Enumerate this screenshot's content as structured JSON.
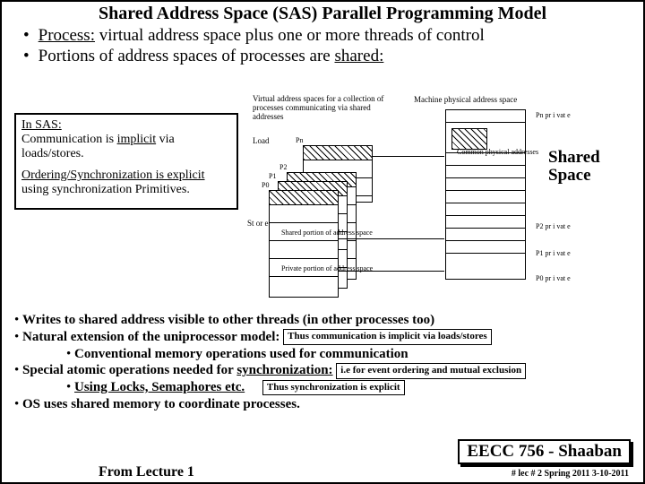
{
  "title": "Shared Address Space (SAS) Parallel Programming Model",
  "top_bullets": {
    "b1_pre": "Process:",
    "b1_post": " virtual address space plus one or more threads of control",
    "b2_pre": "Portions of address spaces of processes are ",
    "b2_u": "shared:"
  },
  "leftbox": {
    "p1_u": "In SAS:",
    "p1_rest_a": "Communication is ",
    "p1_rest_b": "implicit",
    "p1_rest_c": " via loads/stores.",
    "p2_a": "Ordering/Synchronization is ",
    "p2_b": "explicit",
    "p2_c": " using synchronization Primitives."
  },
  "diagram": {
    "caption1": "Virtual address spaces for a collection of processes communicating via shared addresses",
    "caption2": "Machine physical address space",
    "load": "Load",
    "store": "St or e",
    "pn": "Pn",
    "p2": "P2",
    "p1": "P1",
    "p0": "P0",
    "shared_portion": "Shared portion of address space",
    "private_portion": "Private portion of address space",
    "common_phys": "Common physical addresses",
    "pn_priv": "Pn pr i vat e",
    "p2_priv": "P2 pr i vat e",
    "p1_priv": "P1 pr i vat e",
    "p0_priv": "P0 pr i vat e",
    "shared_space": "Shared Space"
  },
  "bullets2": {
    "b1": "Writes to shared address visible to other threads (in other processes too)",
    "b2": "Natural extension of the uniprocessor model:",
    "b2_box": "Thus communication is implicit via loads/stores",
    "b2s": "Conventional memory operations used for communication",
    "b3_a": "Special atomic operations needed for ",
    "b3_u": "synchronization:",
    "b3_box": "i.e for event ordering and mutual exclusion",
    "b3s": "Using Locks, Semaphores etc.",
    "b3s_box": "Thus synchronization is explicit",
    "b4": "OS uses shared memory to coordinate processes."
  },
  "course": "EECC 756 - Shaaban",
  "footer": "#  lec # 2    Spring 2011   3-10-2011",
  "from": "From Lecture 1"
}
